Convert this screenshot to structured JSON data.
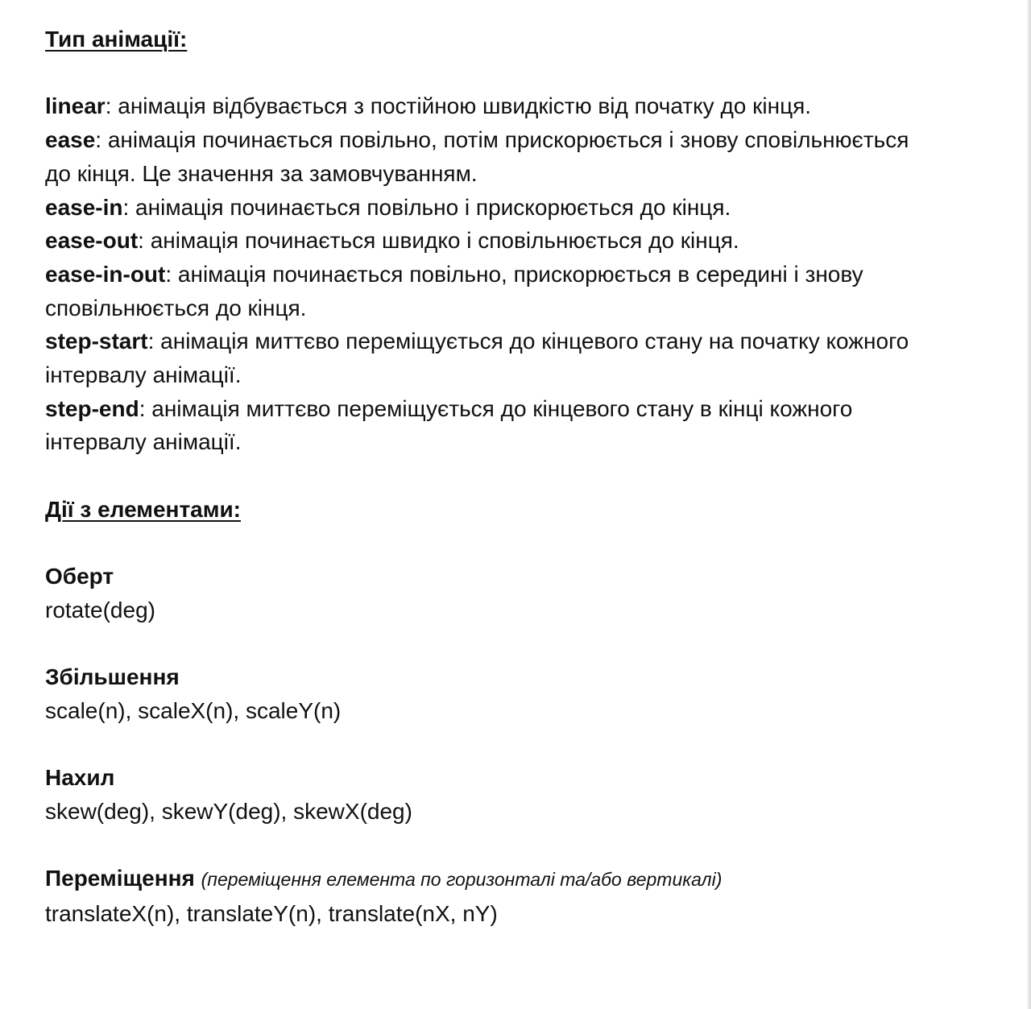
{
  "timing_section": {
    "heading": "Тип анімації:",
    "items": [
      {
        "name": "linear",
        "description": ": анімація відбувається з постійною швидкістю від початку до кінця."
      },
      {
        "name": "ease",
        "description": ": анімація починається повільно, потім прискорюється і знову сповільнюється до кінця. Це значення за замовчуванням."
      },
      {
        "name": "ease-in",
        "description": ": анімація починається повільно і прискорюється до кінця."
      },
      {
        "name": "ease-out",
        "description": ": анімація починається швидко і сповільнюється до кінця."
      },
      {
        "name": "ease-in-out",
        "description": ": анімація починається повільно, прискорюється в середині і знову сповільнюється до кінця."
      },
      {
        "name": "step-start",
        "description": ": анімація миттєво переміщується до кінцевого стану на початку кожного інтервалу анімації."
      },
      {
        "name": "step-end",
        "description": ": анімація миттєво переміщується до кінцевого стану в кінці кожного інтервалу анімації."
      }
    ]
  },
  "actions_section": {
    "heading": "Дії з елементами:",
    "blocks": [
      {
        "title": "Оберт",
        "note": "",
        "code": "rotate(deg)"
      },
      {
        "title": "Збільшення",
        "note": "",
        "code": "scale(n), scaleX(n), scaleY(n)"
      },
      {
        "title": "Нахил",
        "note": "",
        "code": "skew(deg), skewY(deg), skewX(deg)"
      },
      {
        "title": "Переміщення",
        "note": "(переміщення елемента по горизонталі та/або вертикалі)",
        "code": "translateX(n), translateY(n), translate(nX, nY)"
      }
    ]
  }
}
